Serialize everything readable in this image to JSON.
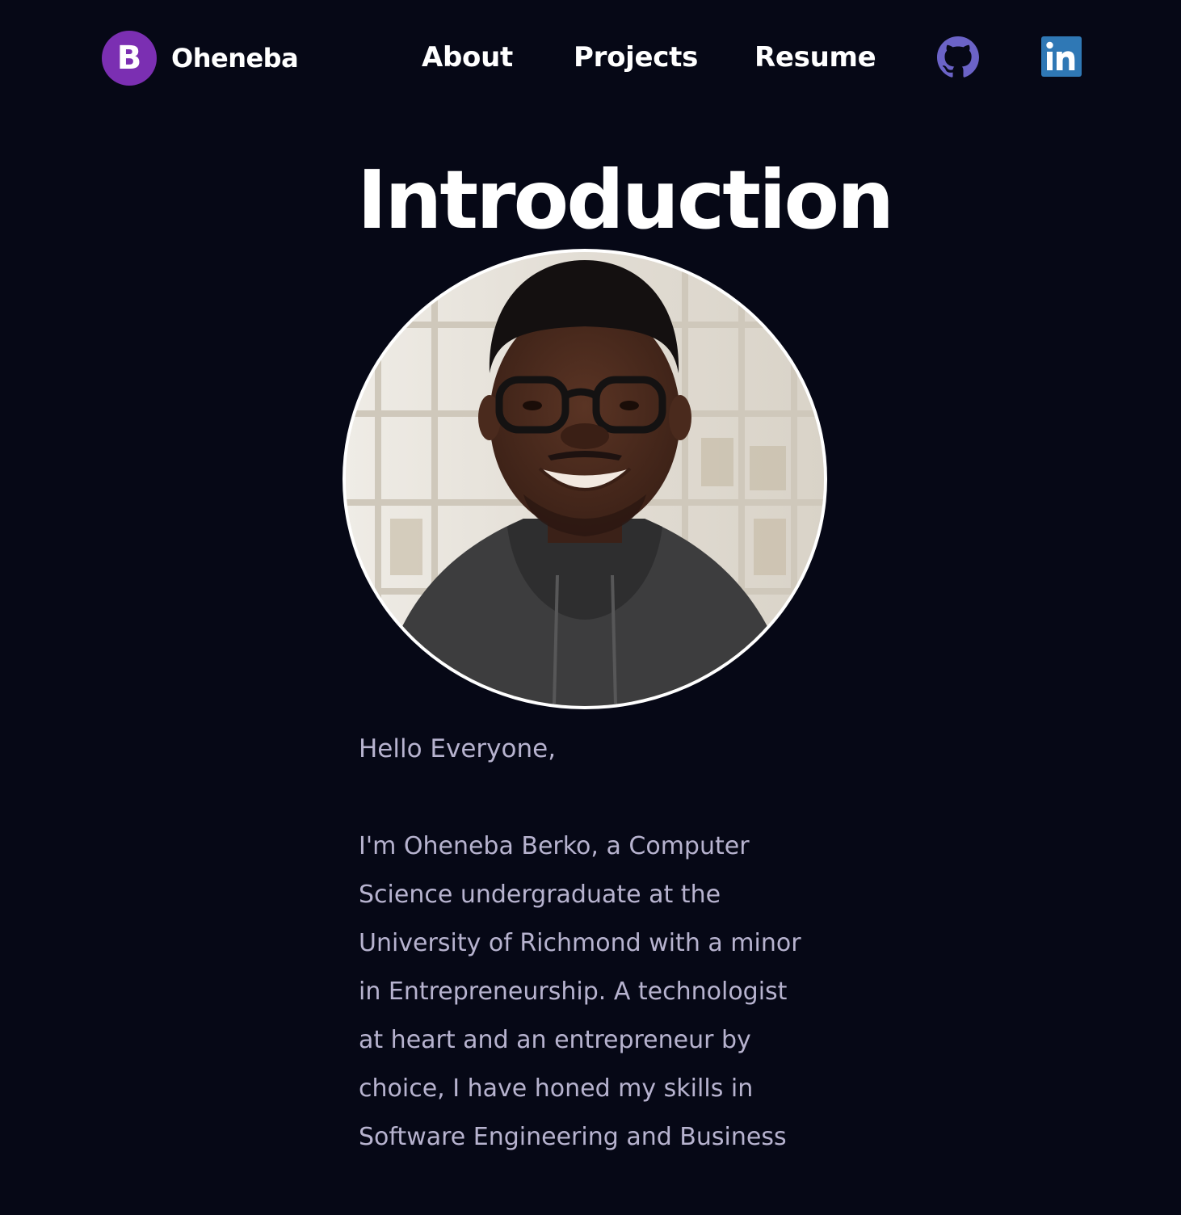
{
  "colors": {
    "background": "#060816",
    "heading": "#ffffff",
    "body_text": "#b7b3cf",
    "brand_logo": "#7b2fb2",
    "github_icon": "#6b63c7",
    "linkedin_icon": "#2f78b5"
  },
  "navbar": {
    "brand": {
      "logo_letter": "B",
      "name": "Oheneba"
    },
    "links": [
      {
        "label": "About"
      },
      {
        "label": "Projects"
      },
      {
        "label": "Resume"
      }
    ],
    "social": [
      {
        "icon": "github-icon"
      },
      {
        "icon": "linkedin-icon"
      }
    ]
  },
  "main": {
    "title": "Introduction",
    "greeting": "Hello Everyone,",
    "bio": "I'm Oheneba Berko, a Computer Science undergraduate at the University of Richmond with a minor in Entrepreneurship. A technologist at heart and an entrepreneur by choice, I have honed my skills in Software Engineering and Business"
  }
}
